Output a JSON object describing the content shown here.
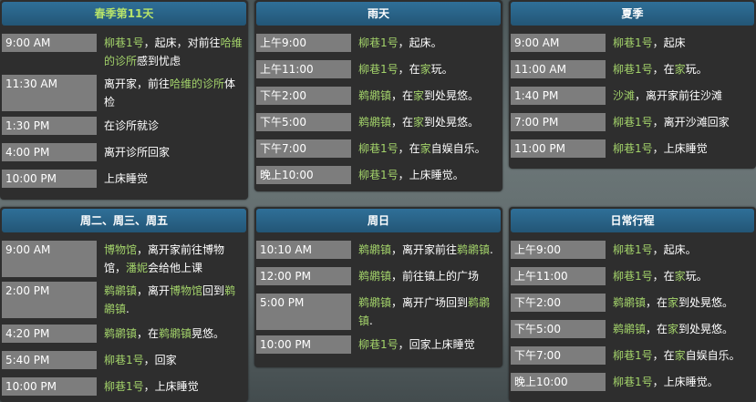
{
  "panels": {
    "spring11": {
      "title": "春季第11天",
      "rows": [
        {
          "time": "9:00 AM",
          "segs": [
            {
              "t": "柳巷1号",
              "hl": true
            },
            {
              "t": "，起床，对前往"
            },
            {
              "t": "哈维的诊所",
              "hl": true
            },
            {
              "t": "感到忧虑"
            }
          ]
        },
        {
          "time": "11:30 AM",
          "segs": [
            {
              "t": "离开家，前往"
            },
            {
              "t": "哈维的诊所",
              "hl": true
            },
            {
              "t": "体检"
            }
          ]
        },
        {
          "time": "1:30 PM",
          "segs": [
            {
              "t": "在诊所就诊"
            }
          ]
        },
        {
          "time": "4:00 PM",
          "segs": [
            {
              "t": "离开诊所回家"
            }
          ]
        },
        {
          "time": "10:00 PM",
          "segs": [
            {
              "t": "上床睡觉"
            }
          ]
        }
      ]
    },
    "rain": {
      "title": "雨天",
      "rows": [
        {
          "time": "上午9:00",
          "segs": [
            {
              "t": "柳巷1号",
              "hl": true
            },
            {
              "t": "，起床。"
            }
          ]
        },
        {
          "time": "上午11:00",
          "segs": [
            {
              "t": "柳巷1号",
              "hl": true
            },
            {
              "t": "，在"
            },
            {
              "t": "家",
              "hl": true
            },
            {
              "t": "玩。"
            }
          ]
        },
        {
          "time": "下午2:00",
          "segs": [
            {
              "t": "鹈鹕镇",
              "hl": true
            },
            {
              "t": "，在"
            },
            {
              "t": "家",
              "hl": true
            },
            {
              "t": "到处晃悠。"
            }
          ]
        },
        {
          "time": "下午5:00",
          "segs": [
            {
              "t": "鹈鹕镇",
              "hl": true
            },
            {
              "t": "，在"
            },
            {
              "t": "家",
              "hl": true
            },
            {
              "t": "到处晃悠。"
            }
          ]
        },
        {
          "time": "下午7:00",
          "segs": [
            {
              "t": "柳巷1号",
              "hl": true
            },
            {
              "t": "，在"
            },
            {
              "t": "家",
              "hl": true
            },
            {
              "t": "自娱自乐。"
            }
          ]
        },
        {
          "time": "晚上10:00",
          "segs": [
            {
              "t": "柳巷1号",
              "hl": true
            },
            {
              "t": "，上床睡觉。"
            }
          ]
        }
      ]
    },
    "summer": {
      "title": "夏季",
      "rows": [
        {
          "time": "9:00 AM",
          "segs": [
            {
              "t": "柳巷1号",
              "hl": true
            },
            {
              "t": "，起床"
            }
          ]
        },
        {
          "time": "11:00 AM",
          "segs": [
            {
              "t": "柳巷1号",
              "hl": true
            },
            {
              "t": "，在"
            },
            {
              "t": "家",
              "hl": true
            },
            {
              "t": "玩。"
            }
          ]
        },
        {
          "time": "1:40 PM",
          "segs": [
            {
              "t": "沙滩",
              "hl": true
            },
            {
              "t": "，离开家前往沙滩"
            }
          ]
        },
        {
          "time": "7:00 PM",
          "segs": [
            {
              "t": "柳巷1号",
              "hl": true
            },
            {
              "t": "，离开沙滩回家"
            }
          ]
        },
        {
          "time": "11:00 PM",
          "segs": [
            {
              "t": "柳巷1号",
              "hl": true
            },
            {
              "t": "，上床睡觉"
            }
          ]
        }
      ]
    },
    "tuewedfri": {
      "title": "周二、周三、周五",
      "rows": [
        {
          "time": "9:00 AM",
          "segs": [
            {
              "t": "博物馆",
              "hl": true
            },
            {
              "t": "，离开家前往博物馆，"
            },
            {
              "t": "潘妮",
              "hl": true
            },
            {
              "t": "会给他上课"
            }
          ]
        },
        {
          "time": "2:00 PM",
          "segs": [
            {
              "t": "鹈鹕镇",
              "hl": true
            },
            {
              "t": "，离开"
            },
            {
              "t": "博物馆",
              "hl": true
            },
            {
              "t": "回到"
            },
            {
              "t": "鹈鹕镇",
              "hl": true
            },
            {
              "t": "."
            }
          ]
        },
        {
          "time": "4:20 PM",
          "segs": [
            {
              "t": "鹈鹕镇",
              "hl": true
            },
            {
              "t": "，在"
            },
            {
              "t": "鹈鹕镇",
              "hl": true
            },
            {
              "t": "晃悠。"
            }
          ]
        },
        {
          "time": "5:40 PM",
          "segs": [
            {
              "t": "柳巷1号",
              "hl": true
            },
            {
              "t": "，回家"
            }
          ]
        },
        {
          "time": "10:00 PM",
          "segs": [
            {
              "t": "柳巷1号",
              "hl": true
            },
            {
              "t": "，上床睡觉"
            }
          ]
        }
      ]
    },
    "sunday": {
      "title": "周日",
      "rows": [
        {
          "time": "10:10 AM",
          "segs": [
            {
              "t": "鹈鹕镇",
              "hl": true
            },
            {
              "t": "，离开家前往"
            },
            {
              "t": "鹈鹕镇",
              "hl": true
            },
            {
              "t": "."
            }
          ]
        },
        {
          "time": "12:00 PM",
          "segs": [
            {
              "t": "鹈鹕镇",
              "hl": true
            },
            {
              "t": "，前往镇上的广场"
            }
          ]
        },
        {
          "time": "5:00 PM",
          "segs": [
            {
              "t": "鹈鹕镇",
              "hl": true
            },
            {
              "t": "，离开广场回到"
            },
            {
              "t": "鹈鹕镇",
              "hl": true
            },
            {
              "t": "."
            }
          ]
        },
        {
          "time": "10:00 PM",
          "segs": [
            {
              "t": "柳巷1号",
              "hl": true
            },
            {
              "t": "，回家上床睡觉"
            }
          ]
        }
      ]
    },
    "daily": {
      "title": "日常行程",
      "rows": [
        {
          "time": "上午9:00",
          "segs": [
            {
              "t": "柳巷1号",
              "hl": true
            },
            {
              "t": "，起床。"
            }
          ]
        },
        {
          "time": "上午11:00",
          "segs": [
            {
              "t": "柳巷1号",
              "hl": true
            },
            {
              "t": "，在"
            },
            {
              "t": "家",
              "hl": true
            },
            {
              "t": "玩。"
            }
          ]
        },
        {
          "time": "下午2:00",
          "segs": [
            {
              "t": "鹈鹕镇",
              "hl": true
            },
            {
              "t": "，在"
            },
            {
              "t": "家",
              "hl": true
            },
            {
              "t": "到处晃悠。"
            }
          ]
        },
        {
          "time": "下午5:00",
          "segs": [
            {
              "t": "鹈鹕镇",
              "hl": true
            },
            {
              "t": "，在"
            },
            {
              "t": "家",
              "hl": true
            },
            {
              "t": "到处晃悠。"
            }
          ]
        },
        {
          "time": "下午7:00",
          "segs": [
            {
              "t": "柳巷1号",
              "hl": true
            },
            {
              "t": "，在"
            },
            {
              "t": "家",
              "hl": true
            },
            {
              "t": "自娱自乐。"
            }
          ]
        },
        {
          "time": "晚上10:00",
          "segs": [
            {
              "t": "柳巷1号",
              "hl": true
            },
            {
              "t": "，上床睡觉。"
            }
          ]
        }
      ]
    }
  },
  "colors": {
    "header_bg": "#2a6388",
    "highlight": "#a3d36a",
    "time_bg": "#7d7d7d",
    "panel_bg": "#2e2e2e"
  }
}
